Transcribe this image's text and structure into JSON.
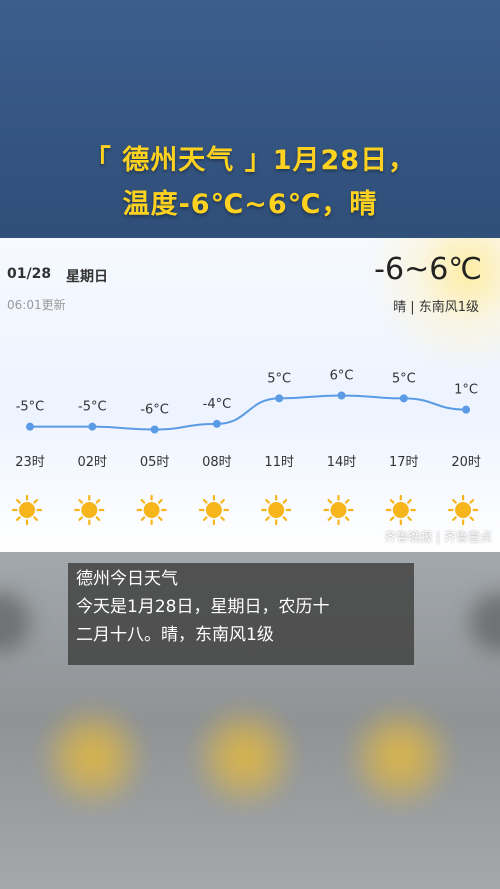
{
  "headline": {
    "line1": "「 德州天气 」1月28日，",
    "line2": "温度-6℃~6℃，晴"
  },
  "card": {
    "date": "01/28",
    "weekday": "星期日",
    "updated": "06:01更新",
    "temp_range": "-6~6℃",
    "condition_wind": "晴 | 东南风1级"
  },
  "chart_data": {
    "type": "line",
    "x": [
      "23时",
      "02时",
      "05时",
      "08时",
      "11时",
      "14时",
      "17时",
      "20时"
    ],
    "values": [
      -5,
      -5,
      -6,
      -4,
      5,
      6,
      5,
      1
    ],
    "point_labels": [
      "-5°C",
      "-5°C",
      "-6°C",
      "-4°C",
      "5°C",
      "6°C",
      "5°C",
      "1°C"
    ],
    "weather_icons": [
      "sun-icon",
      "sun-icon",
      "sun-icon",
      "sun-icon",
      "sun-icon",
      "sun-icon",
      "sun-icon",
      "sun-icon"
    ],
    "line_color": "#5b9be6",
    "ylim": [
      -6,
      6
    ]
  },
  "watermark": "齐鲁晚报 | 齐鲁壹点",
  "caption": {
    "title": "德州今日天气",
    "line1": "今天是1月28日，星期日，农历十",
    "line2": "二月十八。晴，东南风1级"
  },
  "colors": {
    "headline": "#ffd21f",
    "sun": "#f6b51b",
    "background_top": "#3c5e8d"
  }
}
